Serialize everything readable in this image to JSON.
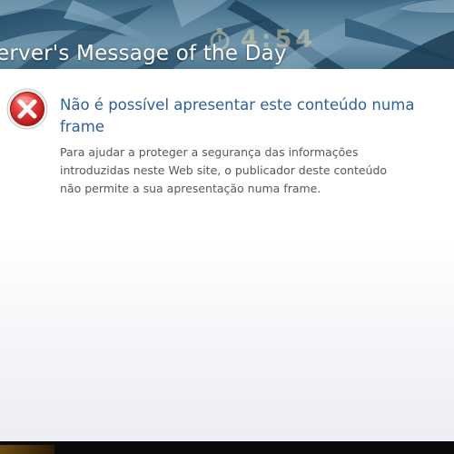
{
  "window": {
    "title": "erver's Message of the Day"
  },
  "hud": {
    "timer": "4:54",
    "timer_icon": "stopwatch-icon"
  },
  "error": {
    "icon": "error-x-icon",
    "icon_color": "#d81e1e",
    "heading": "Não é possível apresentar este conteúdo numa frame",
    "body": "Para ajudar a proteger a segurança das informações introduzidas neste Web site, o publicador deste conteúdo não permite a sua apresentação numa frame.",
    "heading_color": "#2c5f9e"
  }
}
